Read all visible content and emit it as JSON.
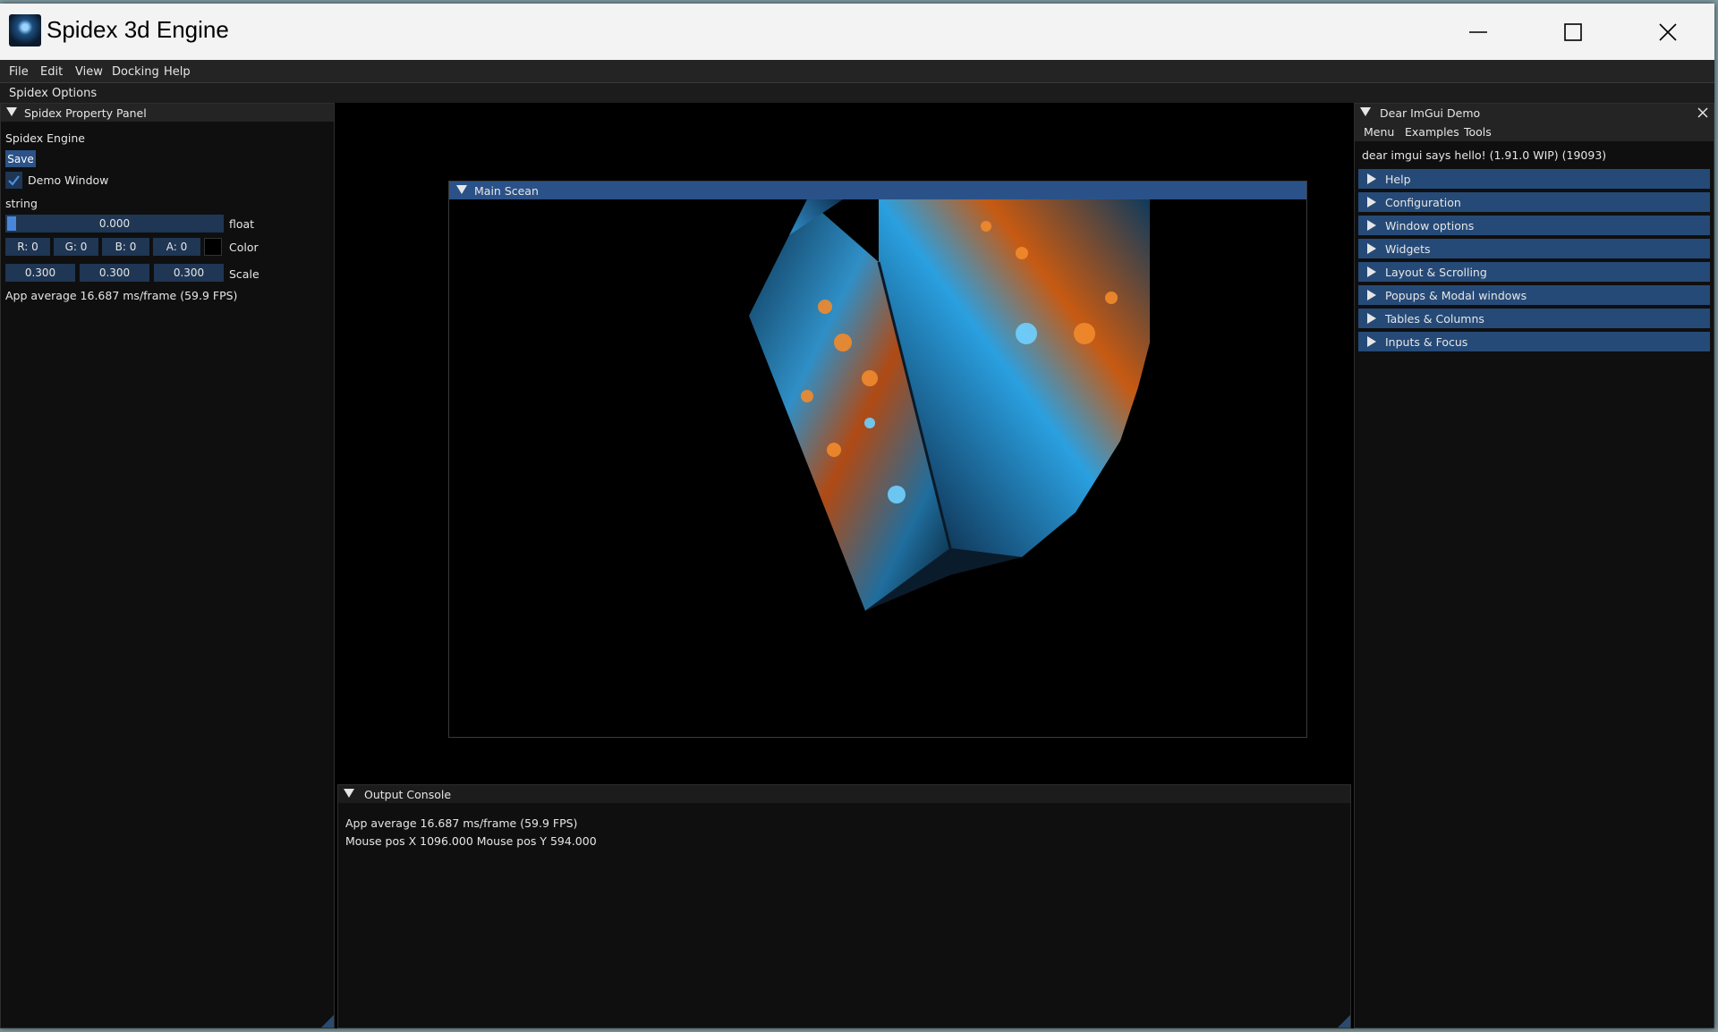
{
  "window": {
    "title": "Spidex 3d Engine",
    "minimize_icon": "minimize-icon",
    "maximize_icon": "maximize-icon",
    "close_icon": "close-icon"
  },
  "menu": [
    "File",
    "Edit",
    "View",
    "Docking",
    "Help"
  ],
  "options_bar": "Spidex Options",
  "property_panel": {
    "title": "Spidex Property Panel",
    "engine_label": "Spidex Engine",
    "save_label": "Save",
    "demo_window_label": "Demo Window",
    "demo_window_checked": true,
    "string_label": "string",
    "float_value": "0.000",
    "float_label": "float",
    "color": {
      "r": "R: 0",
      "g": "G: 0",
      "b": "B: 0",
      "a": "A: 0",
      "label": "Color",
      "swatch": "#000000"
    },
    "scale": {
      "x": "0.300",
      "y": "0.300",
      "z": "0.300",
      "label": "Scale"
    },
    "fps_text": "App average 16.687 ms/frame (59.9 FPS)"
  },
  "main_scene": {
    "title": "Main Scean"
  },
  "console": {
    "title": "Output Console",
    "lines": [
      "App average 16.687 ms/frame (59.9 FPS)",
      "Mouse pos X 1096.000 Mouse pos Y 594.000"
    ]
  },
  "demo": {
    "title": "Dear ImGui Demo",
    "menu": [
      "Menu",
      "Examples",
      "Tools"
    ],
    "hello": "dear imgui says hello! (1.91.0 WIP) (19093)",
    "sections": [
      "Help",
      "Configuration",
      "Window options",
      "Widgets",
      "Layout & Scrolling",
      "Popups & Modal windows",
      "Tables & Columns",
      "Inputs & Focus"
    ]
  },
  "colors": {
    "accent": "#2c5287",
    "header": "#264a77",
    "panel_bg": "#0f0f0f"
  }
}
